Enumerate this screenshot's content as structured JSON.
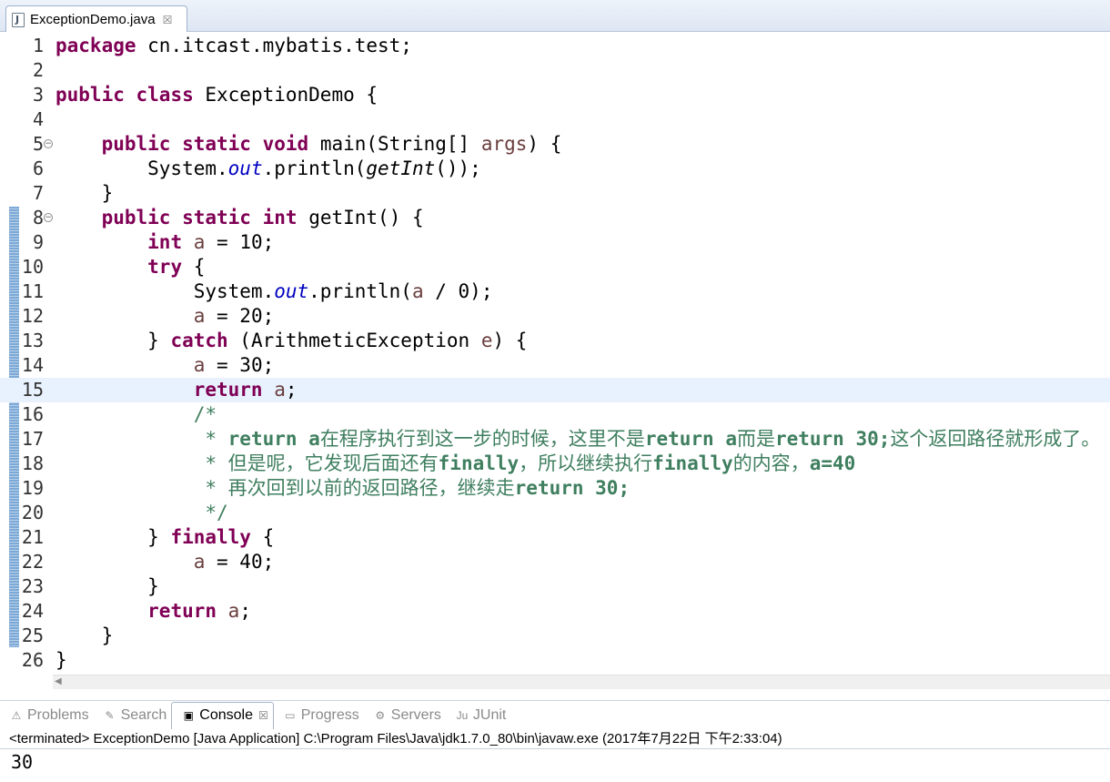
{
  "editor": {
    "tab": {
      "label": "ExceptionDemo.java",
      "close": "☒"
    },
    "lines": [
      [
        {
          "t": "package",
          "c": "kw"
        },
        {
          "t": " cn.itcast.mybatis.test;"
        }
      ],
      [],
      [
        {
          "t": "public",
          "c": "kw"
        },
        {
          "t": " "
        },
        {
          "t": "class",
          "c": "kw"
        },
        {
          "t": " ExceptionDemo {"
        }
      ],
      [],
      [
        {
          "t": "    "
        },
        {
          "t": "public",
          "c": "kw"
        },
        {
          "t": " "
        },
        {
          "t": "static",
          "c": "kw"
        },
        {
          "t": " "
        },
        {
          "t": "void",
          "c": "kw"
        },
        {
          "t": " main(String[] "
        },
        {
          "t": "args",
          "c": "var"
        },
        {
          "t": ") {"
        }
      ],
      [
        {
          "t": "        System."
        },
        {
          "t": "out",
          "c": "fld"
        },
        {
          "t": ".println("
        },
        {
          "t": "getInt",
          "c": "mth"
        },
        {
          "t": "());"
        }
      ],
      [
        {
          "t": "    }"
        }
      ],
      [
        {
          "t": "    "
        },
        {
          "t": "public",
          "c": "kw"
        },
        {
          "t": " "
        },
        {
          "t": "static",
          "c": "kw"
        },
        {
          "t": " "
        },
        {
          "t": "int",
          "c": "kw"
        },
        {
          "t": " getInt() {"
        }
      ],
      [
        {
          "t": "        "
        },
        {
          "t": "int",
          "c": "kw"
        },
        {
          "t": " "
        },
        {
          "t": "a",
          "c": "var"
        },
        {
          "t": " = 10;"
        }
      ],
      [
        {
          "t": "        "
        },
        {
          "t": "try",
          "c": "kw"
        },
        {
          "t": " {"
        }
      ],
      [
        {
          "t": "            System."
        },
        {
          "t": "out",
          "c": "fld"
        },
        {
          "t": ".println("
        },
        {
          "t": "a",
          "c": "var"
        },
        {
          "t": " / 0);"
        }
      ],
      [
        {
          "t": "            "
        },
        {
          "t": "a",
          "c": "var"
        },
        {
          "t": " = 20;"
        }
      ],
      [
        {
          "t": "        } "
        },
        {
          "t": "catch",
          "c": "kw"
        },
        {
          "t": " (ArithmeticException "
        },
        {
          "t": "e",
          "c": "var"
        },
        {
          "t": ") {"
        }
      ],
      [
        {
          "t": "            "
        },
        {
          "t": "a",
          "c": "var"
        },
        {
          "t": " = 30;"
        }
      ],
      [
        {
          "t": "            "
        },
        {
          "t": "return",
          "c": "kw"
        },
        {
          "t": " "
        },
        {
          "t": "a",
          "c": "var"
        },
        {
          "t": ";"
        }
      ],
      [
        {
          "t": "            /*",
          "c": "cmt"
        }
      ],
      [
        {
          "t": "             * ",
          "c": "cmt"
        },
        {
          "t": "return a",
          "c": "cmt-kw"
        },
        {
          "t": "在程序执行到这一步的时候，这里不是",
          "c": "cmt"
        },
        {
          "t": "return a",
          "c": "cmt-kw"
        },
        {
          "t": "而是",
          "c": "cmt"
        },
        {
          "t": "return 30;",
          "c": "cmt-kw"
        },
        {
          "t": "这个返回路径就形成了。",
          "c": "cmt"
        }
      ],
      [
        {
          "t": "             * ",
          "c": "cmt"
        },
        {
          "t": "但是呢，它发现后面还有",
          "c": "cmt"
        },
        {
          "t": "finally",
          "c": "cmt-kw"
        },
        {
          "t": "，所以继续执行",
          "c": "cmt"
        },
        {
          "t": "finally",
          "c": "cmt-kw"
        },
        {
          "t": "的内容，",
          "c": "cmt"
        },
        {
          "t": "a=40",
          "c": "cmt-kw"
        }
      ],
      [
        {
          "t": "             * ",
          "c": "cmt"
        },
        {
          "t": "再次回到以前的返回路径，继续走",
          "c": "cmt"
        },
        {
          "t": "return 30;",
          "c": "cmt-kw"
        }
      ],
      [
        {
          "t": "             */",
          "c": "cmt"
        }
      ],
      [
        {
          "t": "        } "
        },
        {
          "t": "finally",
          "c": "kw"
        },
        {
          "t": " {"
        }
      ],
      [
        {
          "t": "            "
        },
        {
          "t": "a",
          "c": "var"
        },
        {
          "t": " = 40;"
        }
      ],
      [
        {
          "t": "        }"
        }
      ],
      [
        {
          "t": "        "
        },
        {
          "t": "return",
          "c": "kw"
        },
        {
          "t": " "
        },
        {
          "t": "a",
          "c": "var"
        },
        {
          "t": ";"
        }
      ],
      [
        {
          "t": "    }"
        }
      ],
      [
        {
          "t": "}"
        }
      ]
    ],
    "current_line": 15,
    "fold_lines": [
      5,
      8
    ],
    "fold_glyph": "⊖"
  },
  "views": {
    "tabs": [
      {
        "label": "Problems",
        "icon": "problems-icon",
        "glyph": "⚠",
        "active": false
      },
      {
        "label": "Search",
        "icon": "search-icon",
        "glyph": "✎",
        "active": false
      },
      {
        "label": "Console",
        "icon": "console-icon",
        "glyph": "▣",
        "active": true,
        "close": "☒"
      },
      {
        "label": "Progress",
        "icon": "progress-icon",
        "glyph": "▭",
        "active": false
      },
      {
        "label": "Servers",
        "icon": "servers-icon",
        "glyph": "⚙",
        "active": false
      },
      {
        "label": "JUnit",
        "icon": "junit-icon",
        "glyph": "Ju",
        "active": false
      }
    ]
  },
  "console": {
    "status": "<terminated> ExceptionDemo [Java Application] C:\\Program Files\\Java\\jdk1.7.0_80\\bin\\javaw.exe (2017年7月22日 下午2:33:04)",
    "output": "30"
  },
  "colors": {
    "keyword": "#7f0055",
    "variable": "#6a3e3e",
    "field": "#0000c0",
    "comment": "#3f7f5f",
    "current_line": "#e8f2fe"
  }
}
